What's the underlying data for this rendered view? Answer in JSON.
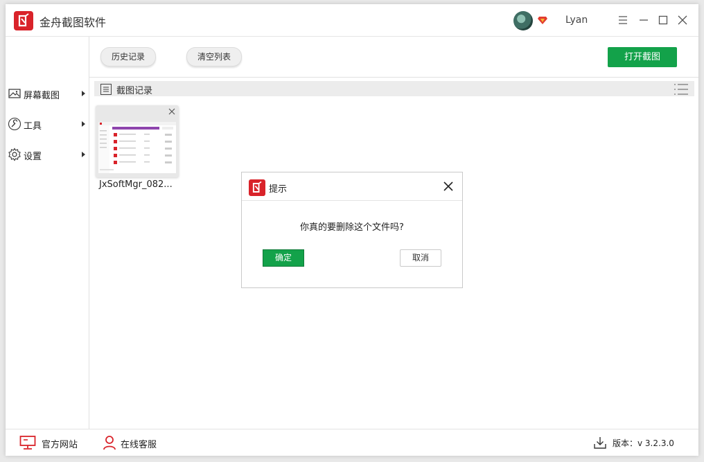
{
  "app": {
    "title": "金舟截图软件"
  },
  "user": {
    "name": "Lyan"
  },
  "toolbar": {
    "history_label": "历史记录",
    "clear_label": "清空列表",
    "open_label": "打开截图"
  },
  "sidebar": {
    "items": [
      {
        "label": "屏幕截图",
        "icon": "image-icon"
      },
      {
        "label": "工具",
        "icon": "wrench-icon"
      },
      {
        "label": "设置",
        "icon": "gear-icon"
      }
    ]
  },
  "section": {
    "title": "截图记录"
  },
  "thumbnails": [
    {
      "name": "JxSoftMgr_082..."
    }
  ],
  "dialog": {
    "title": "提示",
    "message": "你真的要删除这个文件吗?",
    "ok_label": "确定",
    "cancel_label": "取消"
  },
  "footer": {
    "site_label": "官方网站",
    "service_label": "在线客服",
    "version_label": "版本：v 3.2.3.0"
  },
  "colors": {
    "brand_red": "#d9232a",
    "accent_green": "#13a24a"
  }
}
